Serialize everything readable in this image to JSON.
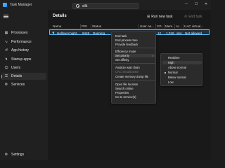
{
  "window": {
    "title": "Task Manager"
  },
  "search": {
    "value": "silk"
  },
  "window_controls": {
    "minimize": "—",
    "maximize": "☐",
    "close": "✕"
  },
  "sidebar": {
    "items": [
      {
        "label": "Processes",
        "icon": "grid-icon",
        "glyph": "▦"
      },
      {
        "label": "Performance",
        "icon": "performance-icon",
        "glyph": "∿"
      },
      {
        "label": "App history",
        "icon": "history-icon",
        "glyph": "↺"
      },
      {
        "label": "Startup apps",
        "icon": "startup-icon",
        "glyph": "↯"
      },
      {
        "label": "Users",
        "icon": "users-icon",
        "glyph": "☺"
      },
      {
        "label": "Details",
        "icon": "details-icon",
        "glyph": "☰"
      },
      {
        "label": "Services",
        "icon": "services-icon",
        "glyph": "⚙"
      }
    ],
    "active_index": 5,
    "settings": {
      "label": "Settings",
      "icon": "settings-icon",
      "glyph": "⚙"
    }
  },
  "main": {
    "title": "Details",
    "run_new_task": {
      "label": "Run new task",
      "icon": "run-task-icon",
      "glyph": "⊞"
    },
    "end_task": {
      "label": "End task",
      "icon": "end-task-icon",
      "glyph": "⊘"
    }
  },
  "table": {
    "columns": [
      "Name",
      "PID",
      "Status",
      "User na...",
      "CP...",
      "Mem...",
      "Ar...",
      "UAC virtual..."
    ],
    "row": {
      "name": "Hollow Knight...",
      "pid": "9448",
      "status": "Running",
      "user": "kk40",
      "cpu": "12",
      "memory": "1,018,...",
      "arch": "x64",
      "uac": "Not allowed"
    }
  },
  "context_menu": {
    "items": [
      {
        "label": "End task",
        "dim": false,
        "submenu": false
      },
      {
        "label": "End process tree",
        "dim": false,
        "submenu": false
      },
      {
        "label": "Provide feedback",
        "dim": false,
        "submenu": false
      },
      {
        "separator": true
      },
      {
        "label": "Efficiency mode",
        "dim": false,
        "submenu": false
      },
      {
        "label": "Set priority",
        "dim": false,
        "submenu": true,
        "highlight": true
      },
      {
        "label": "Set affinity",
        "dim": false,
        "submenu": false
      },
      {
        "separator": true
      },
      {
        "label": "Analyze wait chain",
        "dim": false,
        "submenu": false
      },
      {
        "label": "UAC virtualization",
        "dim": true,
        "submenu": false
      },
      {
        "label": "Create memory dump file",
        "dim": false,
        "submenu": false
      },
      {
        "separator": true
      },
      {
        "label": "Open file location",
        "dim": false,
        "submenu": false
      },
      {
        "label": "Search online",
        "dim": false,
        "submenu": false
      },
      {
        "label": "Properties",
        "dim": false,
        "submenu": false
      },
      {
        "label": "Go to service(s)",
        "dim": false,
        "submenu": false
      }
    ]
  },
  "priority_submenu": {
    "items": [
      "Realtime",
      "High",
      "Above normal",
      "Normal",
      "Below normal",
      "Low"
    ],
    "selected": "Normal",
    "highlighted": "High"
  }
}
